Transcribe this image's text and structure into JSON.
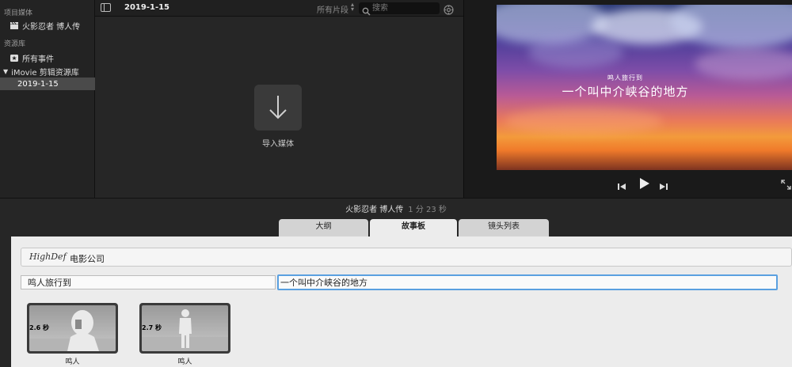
{
  "sidebar": {
    "project_heading": "项目媒体",
    "project_item": "火影忍者 博人传",
    "library_heading": "资源库",
    "all_events": "所有事件",
    "library_name": "iMovie 剪辑资源库",
    "event_date": "2019-1-15"
  },
  "browser": {
    "event_title": "2019-1-15",
    "filter_label": "所有片段",
    "search_placeholder": "搜索",
    "import_label": "导入媒体"
  },
  "viewer": {
    "overlay_subtitle": "鸣人旅行到",
    "overlay_title": "一个叫中介峡谷的地方"
  },
  "timeline": {
    "project_name": "火影忍者 博人传",
    "duration": "1 分 23 秒",
    "tabs": [
      {
        "label": "大纲"
      },
      {
        "label": "故事板"
      },
      {
        "label": "镜头列表"
      }
    ],
    "active_tab": "故事板",
    "brand_logo": "HighDef",
    "brand_name": "电影公司",
    "line1_value": "鸣人旅行到",
    "line2_value": "一个叫中介峡谷的地方",
    "shots": [
      {
        "duration": "2.6 秒",
        "label": "鸣人"
      },
      {
        "duration": "2.7 秒",
        "label": "鸣人"
      }
    ]
  },
  "colors": {
    "focus_ring": "#5aa0e0",
    "panel_bg": "#ececec",
    "dark_bg": "#262626"
  }
}
